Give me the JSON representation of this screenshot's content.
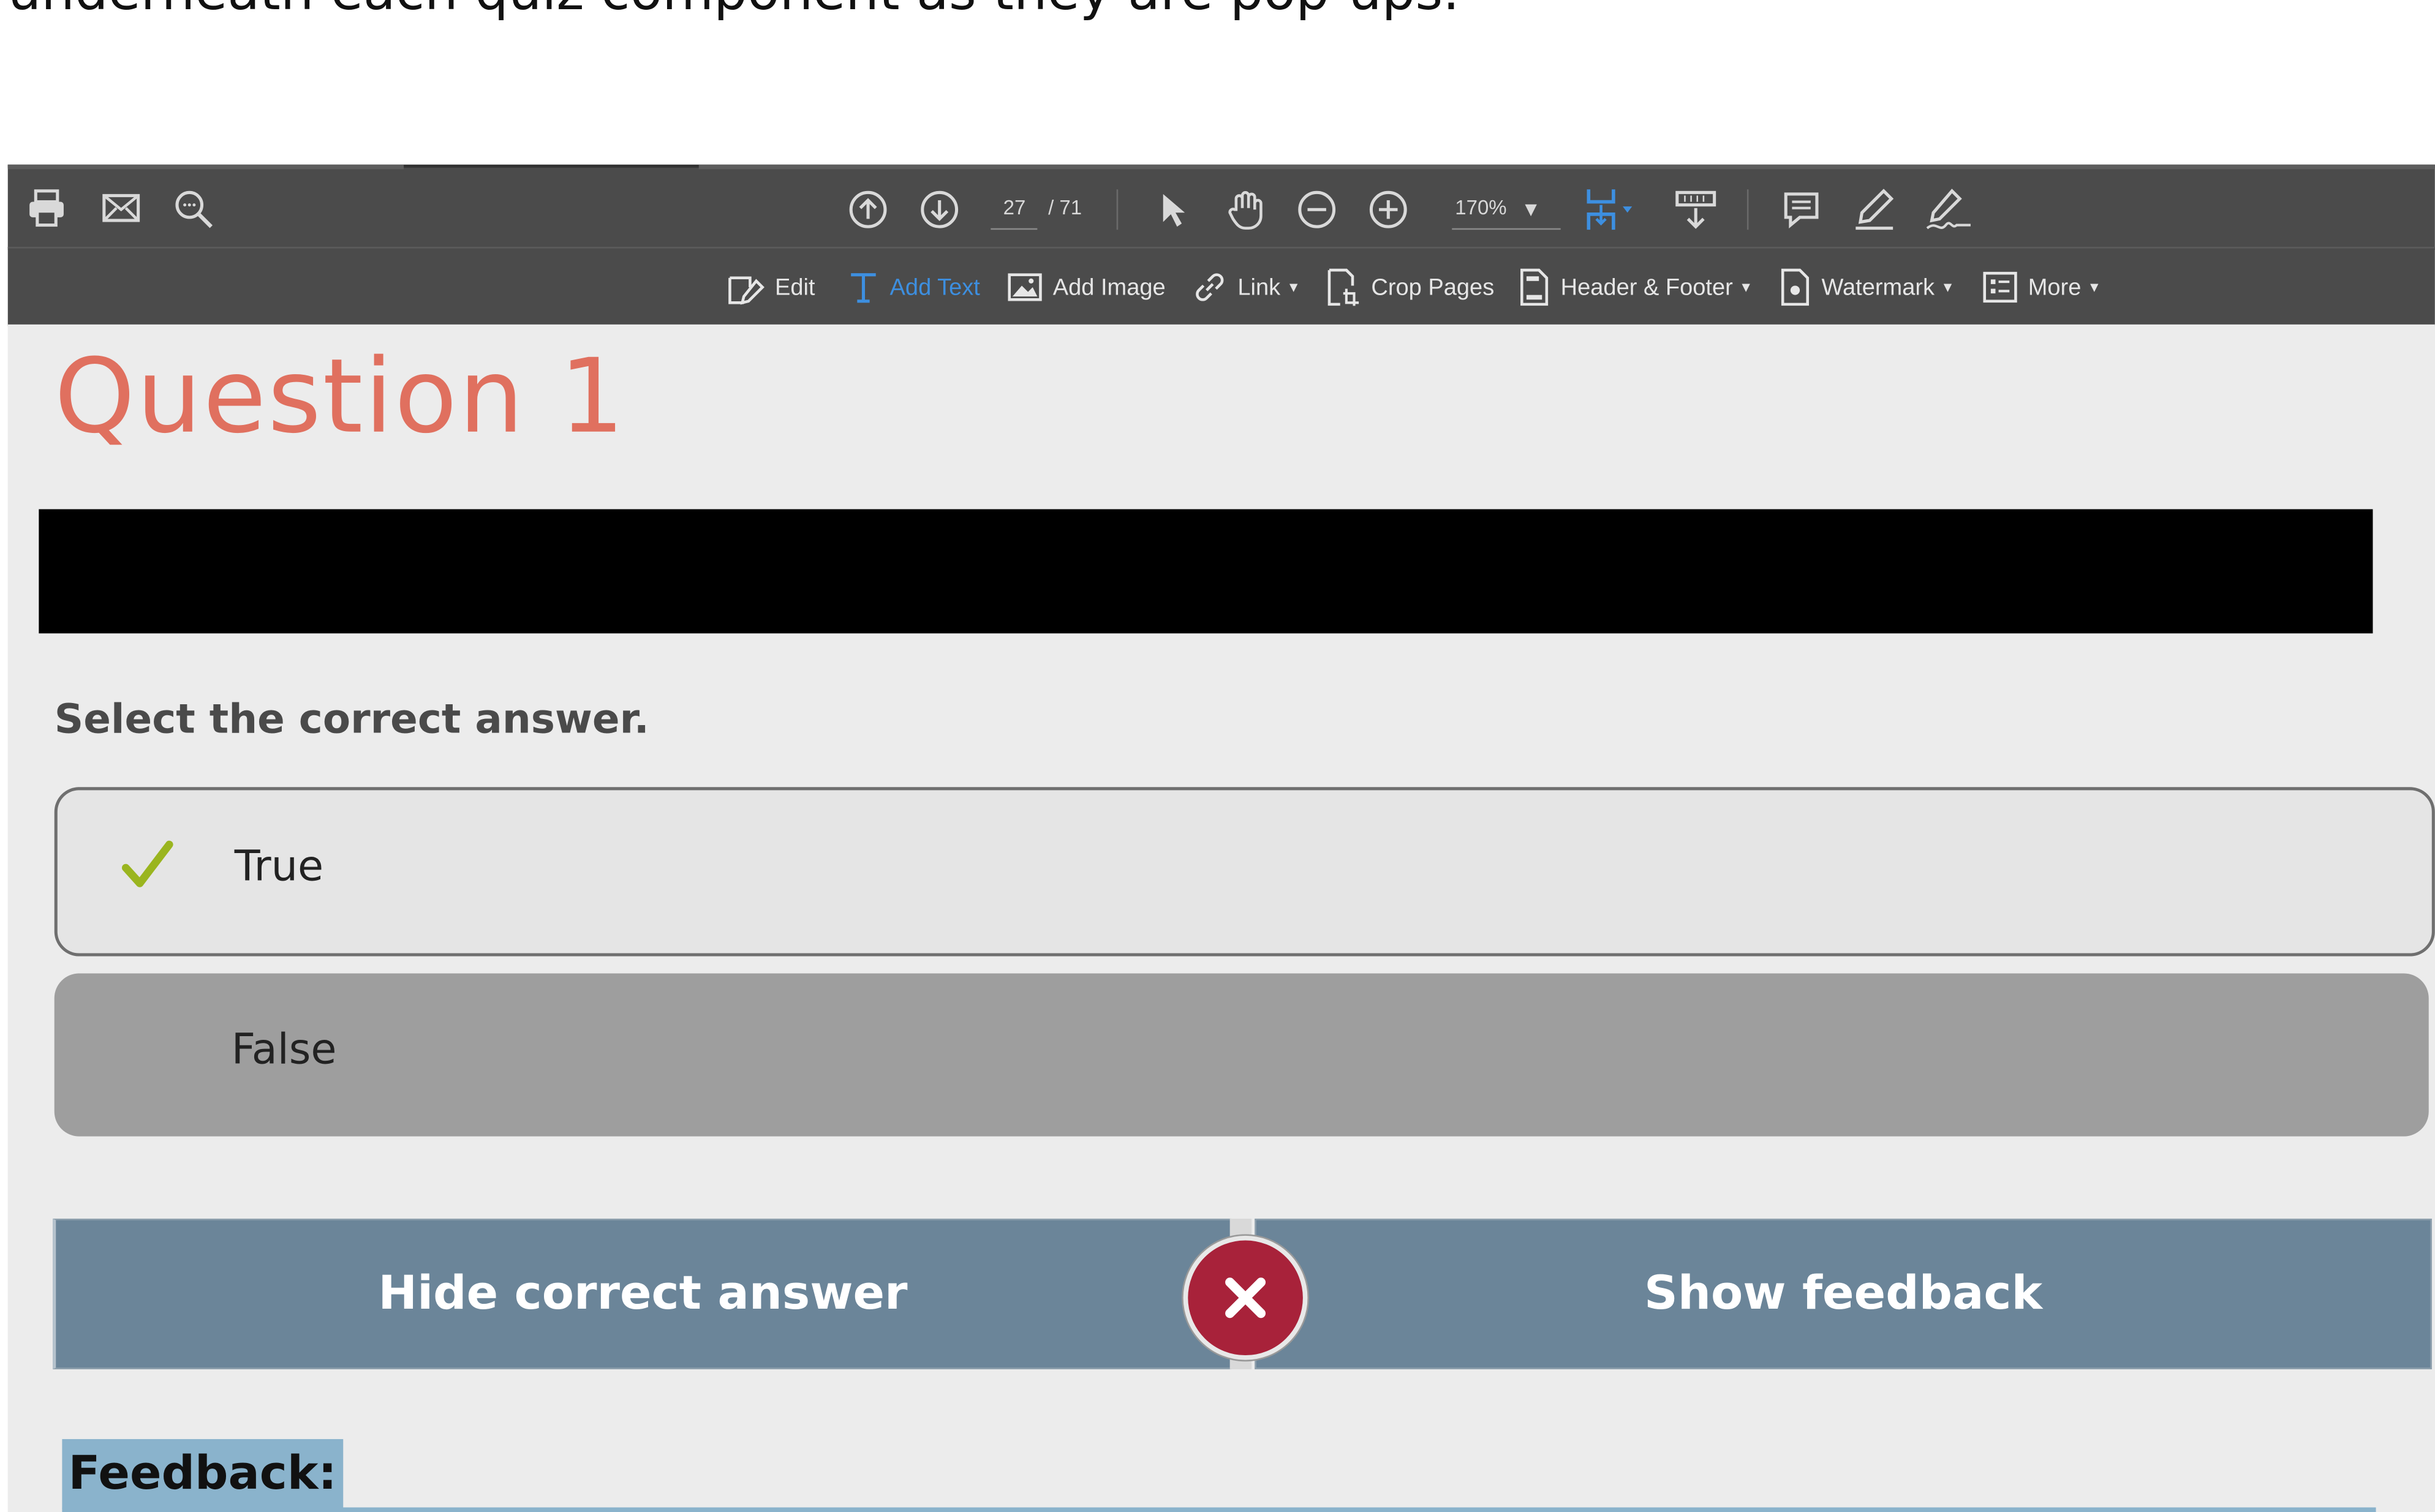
{
  "caption": "underneath each quiz component as they are pop-ups.",
  "toolbar_top": {
    "left_icons": [
      "printer-icon",
      "email-icon",
      "search-zoom-icon"
    ],
    "page_current": "27",
    "page_total": "/ 71",
    "zoom": "170%",
    "nav_icons": [
      "page-up-icon",
      "page-down-icon"
    ],
    "tool_icons": [
      "select-arrow-icon",
      "hand-icon",
      "zoom-out-icon",
      "zoom-in-icon",
      "fit-page-icon",
      "scroll-mode-icon",
      "comment-icon",
      "highlight-icon",
      "sign-icon"
    ]
  },
  "toolbar_edit": {
    "edit": "Edit",
    "add_text": "Add Text",
    "add_image": "Add Image",
    "link": "Link",
    "crop_pages": "Crop Pages",
    "header_footer": "Header & Footer",
    "watermark": "Watermark",
    "more": "More"
  },
  "quiz": {
    "title": "Question 1",
    "instruction": "Select the correct answer.",
    "options": [
      {
        "label": "True",
        "correct": true
      },
      {
        "label": "False",
        "correct": false
      }
    ],
    "hide_button": "Hide correct answer",
    "feedback_button": "Show feedback",
    "feedback_heading": "Feedback:"
  },
  "colors": {
    "title": "#e0705f",
    "button": "#6b8599",
    "close_badge": "#a8223a",
    "check": "#9ab51f",
    "accent_blue": "#3d8fe0"
  }
}
